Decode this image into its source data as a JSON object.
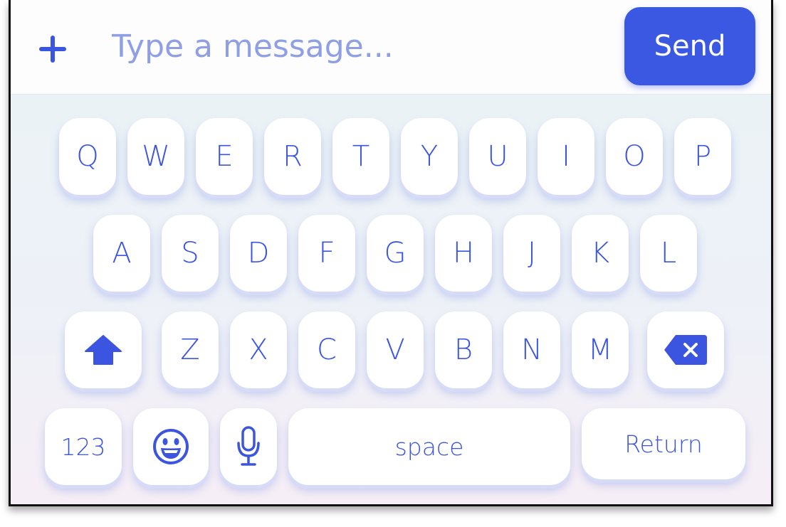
{
  "composer": {
    "placeholder": "Type a message...",
    "send_label": "Send"
  },
  "keyboard": {
    "row1": [
      "Q",
      "W",
      "E",
      "R",
      "T",
      "Y",
      "U",
      "I",
      "O",
      "P"
    ],
    "row2": [
      "A",
      "S",
      "D",
      "F",
      "G",
      "H",
      "J",
      "K",
      "L"
    ],
    "row3": [
      "Z",
      "X",
      "C",
      "V",
      "B",
      "N",
      "M"
    ],
    "numbers_label": "123",
    "space_label": "space",
    "return_label": "Return",
    "icons": [
      "plus-icon",
      "shift-icon",
      "backspace-icon",
      "emoji-icon",
      "microphone-icon"
    ]
  },
  "colors": {
    "accent": "#3b58e2",
    "key_text": "#3b55e0",
    "placeholder": "#8f9fe6"
  }
}
